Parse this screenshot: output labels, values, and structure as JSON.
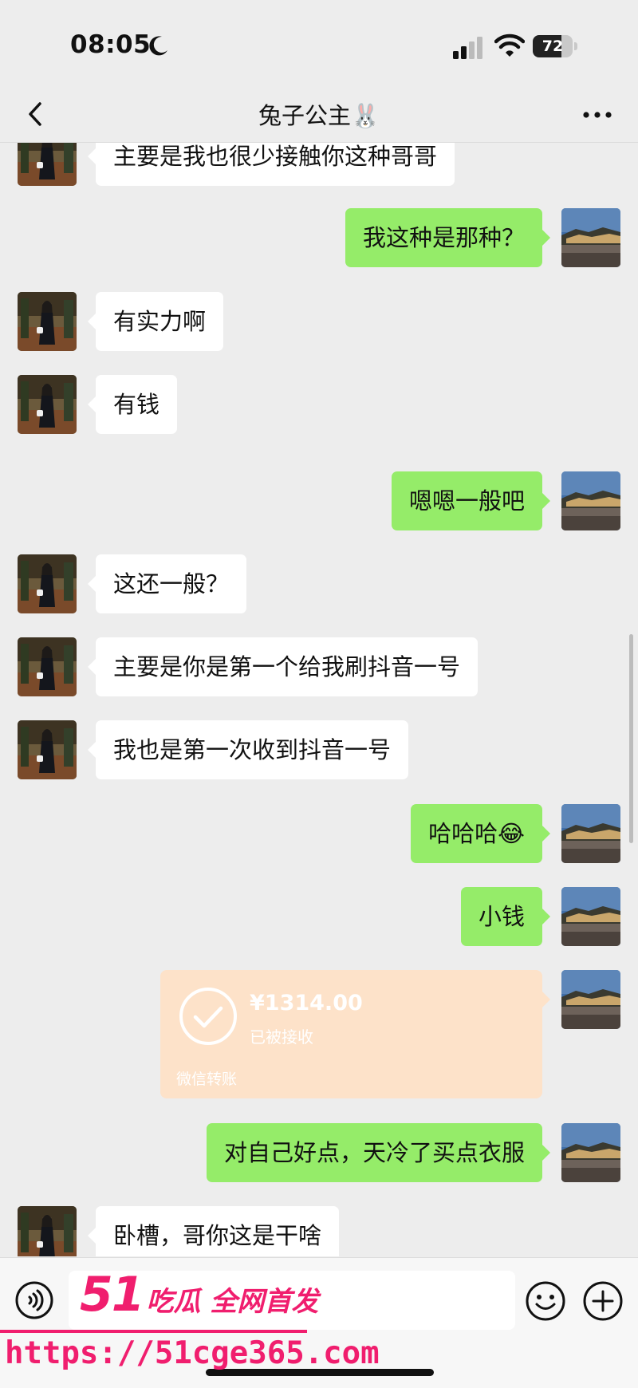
{
  "status_bar": {
    "time": "08:05",
    "battery": "72",
    "battery_level": 0.72
  },
  "header": {
    "title": "兔子公主🐰"
  },
  "messages": [
    {
      "side": "in",
      "text": "主要是我也很少接触你这种哥哥"
    },
    {
      "side": "out",
      "text": "我这种是那种？"
    },
    {
      "side": "in",
      "text": "有实力啊"
    },
    {
      "side": "in",
      "text": "有钱"
    },
    {
      "side": "out",
      "text": "嗯嗯一般吧"
    },
    {
      "side": "in",
      "text": "这还一般？"
    },
    {
      "side": "in",
      "text": "主要是你是第一个给我刷抖音一号"
    },
    {
      "side": "in",
      "text": "我也是第一次收到抖音一号"
    },
    {
      "side": "out",
      "text": "哈哈哈😂"
    },
    {
      "side": "out",
      "text": "小钱"
    },
    {
      "side": "out",
      "type": "transfer",
      "amount": "¥1314.00",
      "status": "已被接收",
      "label": "微信转账"
    },
    {
      "side": "out",
      "text": "对自己好点，天冷了买点衣服"
    },
    {
      "side": "in",
      "text": "卧槽，哥你这是干啥"
    }
  ],
  "watermark": {
    "logo_number": "51",
    "logo_text": "吃瓜 全网首发",
    "url": "https://51cge365.com"
  },
  "icons": {
    "back": "chevron-left-icon",
    "more": "more-dots-icon",
    "voice": "voice-icon",
    "emoji": "emoji-icon",
    "plus": "plus-icon"
  },
  "colors": {
    "outgoing_bubble": "#95ec69",
    "incoming_bubble": "#ffffff",
    "transfer_card": "#fde2c9",
    "watermark": "#f01e6e"
  }
}
